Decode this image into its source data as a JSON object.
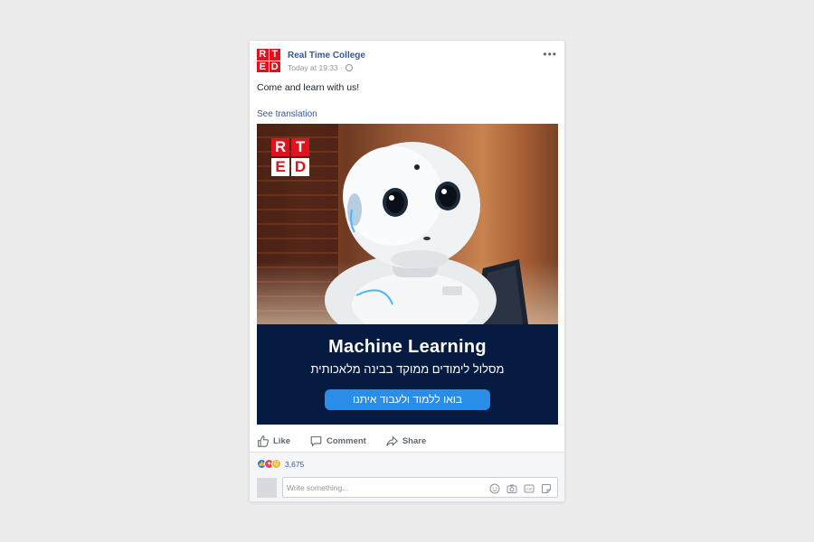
{
  "post": {
    "page_name": "Real Time College",
    "timestamp": "Today at 19:33 ·",
    "privacy_icon": "globe-icon",
    "text": "Come and learn with us!",
    "see_translation": "See translation",
    "logo_letters": [
      "RT",
      "ED"
    ]
  },
  "ad": {
    "title": "Machine Learning",
    "subtitle": "מסלול לימודים ממוקד בבינה מלאכותית",
    "cta": "בואו ללמוד ולעבוד איתנו",
    "colors": {
      "banner": "#061b41",
      "button": "#2a8de8",
      "logo_red": "#e0121d"
    }
  },
  "actions": {
    "like": "Like",
    "comment": "Comment",
    "share": "Share"
  },
  "reactions": {
    "icons": [
      "like-icon",
      "love-icon",
      "wow-icon"
    ],
    "count": "3,675"
  },
  "comment_box": {
    "placeholder": "Write something...",
    "icons": [
      "emoji-icon",
      "camera-icon",
      "gif-icon",
      "sticker-icon"
    ]
  }
}
